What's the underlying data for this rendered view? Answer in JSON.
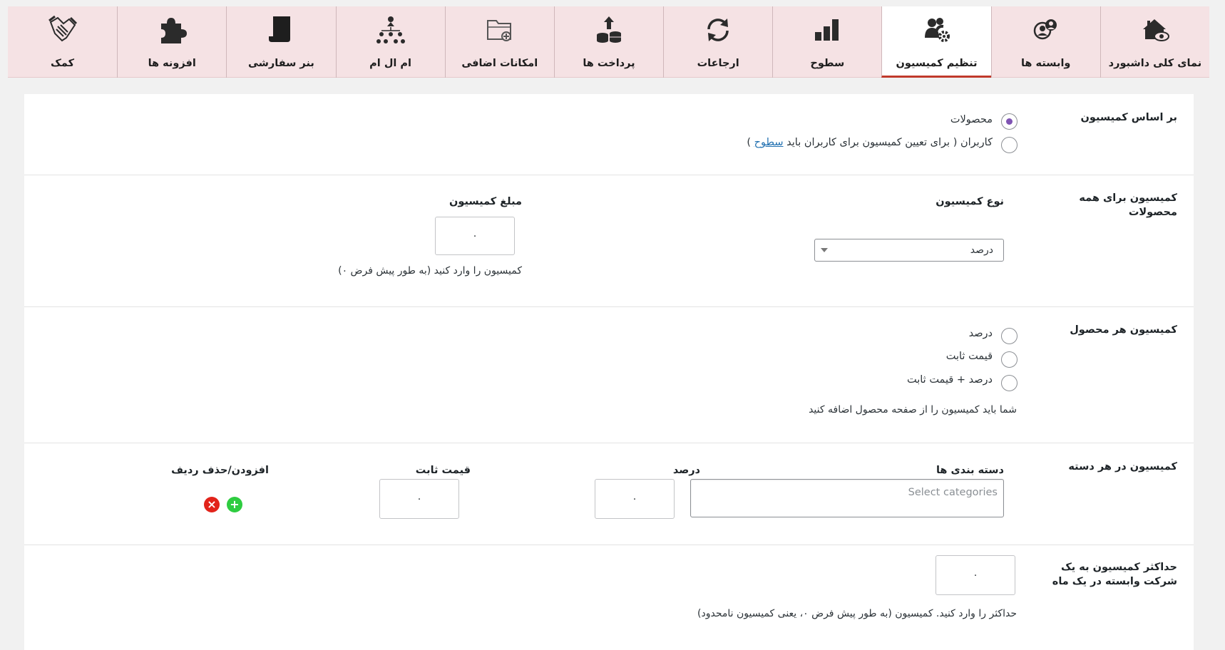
{
  "tabs": [
    {
      "label": "نمای کلی داشبورد",
      "icon": "house-eye-icon",
      "active": false
    },
    {
      "label": "وابسته ها",
      "icon": "users-icon",
      "active": false
    },
    {
      "label": "تنظیم کمیسیون",
      "icon": "users-gear-icon",
      "active": true
    },
    {
      "label": "سطوح",
      "icon": "bar-chart-icon",
      "active": false
    },
    {
      "label": "ارجاعات",
      "icon": "refresh-icon",
      "active": false
    },
    {
      "label": "پرداخت ها",
      "icon": "coins-upload-icon",
      "active": false
    },
    {
      "label": "امکانات اضافی",
      "icon": "folder-add-icon",
      "active": false
    },
    {
      "label": "ام ال ام",
      "icon": "hierarchy-icon",
      "active": false
    },
    {
      "label": "بنر سفارشی",
      "icon": "scroll-icon",
      "active": false
    },
    {
      "label": "افزونه ها",
      "icon": "puzzle-icon",
      "active": false
    },
    {
      "label": "کمک",
      "icon": "handshake-icon",
      "active": false
    }
  ],
  "basis": {
    "label": "بر اساس کمیسیون",
    "opt_products": "محصولات",
    "opt_users_prefix": "کاربران ( برای تعیین کمیسیون برای کاربران باید",
    "opt_users_link": "سطوح",
    "opt_users_suffix": ")",
    "selected": "products"
  },
  "all_products": {
    "label_line1": "کمیسیون برای همه",
    "label_line2": "محصولات",
    "type_label": "نوع کمیسیون",
    "type_value": "درصد",
    "amount_label": "مبلغ کمیسیون",
    "amount_value": "۰",
    "amount_hint": "کمیسیون را وارد کنید (به طور پیش فرض ۰)"
  },
  "per_product": {
    "label": "کمیسیون هر محصول",
    "opt1": "درصد",
    "opt2": "قیمت ثابت",
    "opt3": "درصد + قیمت ثابت",
    "hint": "شما باید کمیسیون را از صفحه محصول اضافه کنید"
  },
  "per_category": {
    "label": "کمیسیون در هر دسته",
    "col_categories": "دسته بندی ها",
    "col_percent": "درصد",
    "col_fixed": "قیمت ثابت",
    "col_addremove": "افزودن/حذف ردیف",
    "categories_placeholder": "Select categories",
    "percent_value": "۰",
    "fixed_value": "۰"
  },
  "monthly_max": {
    "label_line1": "حداکثر کمیسیون به یک",
    "label_line2": "شرکت وابسته در یک ماه",
    "value": "۰",
    "hint": "حداکثر را وارد کنید. کمیسیون (به طور پیش فرض ۰، یعنی کمیسیون نامحدود)"
  },
  "colors": {
    "accent": "#c0392b",
    "tabs_bg": "#f5e2e4",
    "radio_on": "#7f54b3",
    "add": "#2ecc40",
    "remove": "#e2231a"
  }
}
